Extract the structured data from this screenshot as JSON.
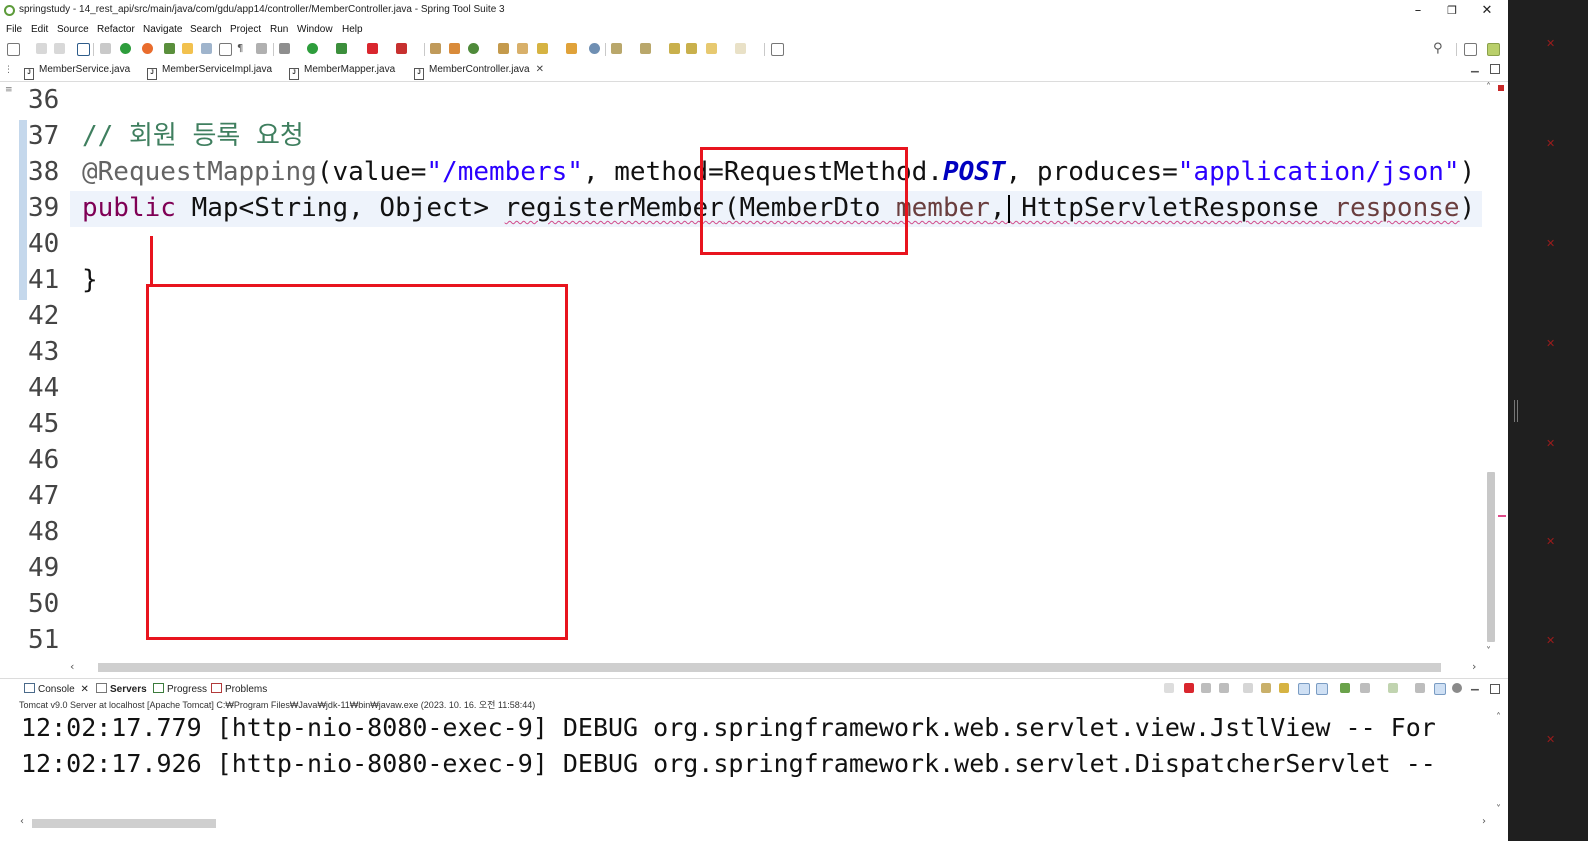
{
  "window": {
    "title": "springstudy - 14_rest_api/src/main/java/com/gdu/app14/controller/MemberController.java - Spring Tool Suite 3",
    "minimize": "–",
    "restore": "❐",
    "close": "✕"
  },
  "menu": [
    "File",
    "Edit",
    "Source",
    "Refactor",
    "Navigate",
    "Search",
    "Project",
    "Run",
    "Window",
    "Help"
  ],
  "editor_tabs": [
    {
      "label": "MemberService.java",
      "active": false
    },
    {
      "label": "MemberServiceImpl.java",
      "active": false
    },
    {
      "label": "MemberMapper.java",
      "active": false
    },
    {
      "label": "MemberController.java",
      "active": true,
      "close": "✕"
    }
  ],
  "editor": {
    "line_numbers": [
      "36",
      "37",
      "38",
      "39",
      "40",
      "41",
      "42",
      "43",
      "44",
      "45",
      "46",
      "47",
      "48",
      "49",
      "50",
      "51"
    ],
    "line37": {
      "comment": "// 회원 등록 요청"
    },
    "line38": {
      "annotation": "@RequestMapping",
      "p1": "(value=",
      "s1": "\"/members\"",
      "p2": ", method=RequestMethod.",
      "const": "POST",
      "p3": ", produces=",
      "s2": "\"application/json\"",
      "p4": ")"
    },
    "line39": {
      "kw": "public",
      "p1": " Map<String, Object> ",
      "method": "registerMember",
      "p2": "(MemberDto ",
      "param1": "member",
      "p3": ", HttpServletResponse ",
      "param2": "response",
      "p4": ")"
    },
    "line41": {
      "text": "}"
    }
  },
  "panel": {
    "tabs": [
      {
        "label": "Console",
        "close": "✕"
      },
      {
        "label": "Servers"
      },
      {
        "label": "Progress"
      },
      {
        "label": "Problems"
      }
    ],
    "server_description": "Tomcat v9.0 Server at localhost [Apache Tomcat] C:₩Program Files₩Java₩jdk-11₩bin₩javaw.exe  (2023. 10. 16. 오전 11:58:44)",
    "console_lines": [
      "12:02:17.779 [http-nio-8080-exec-9] DEBUG org.springframework.web.servlet.view.JstlView -- For",
      "12:02:17.926 [http-nio-8080-exec-9] DEBUG org.springframework.web.servlet.DispatcherServlet --"
    ]
  },
  "colors": {
    "highlight_box": "#e8141e",
    "comment": "#3f7f5f",
    "keyword": "#7f0055",
    "string": "#2a00ff"
  },
  "icons": {
    "search": "⚲",
    "scroll_up": "˄",
    "scroll_down": "˅",
    "scroll_left": "‹",
    "scroll_right": "›"
  }
}
